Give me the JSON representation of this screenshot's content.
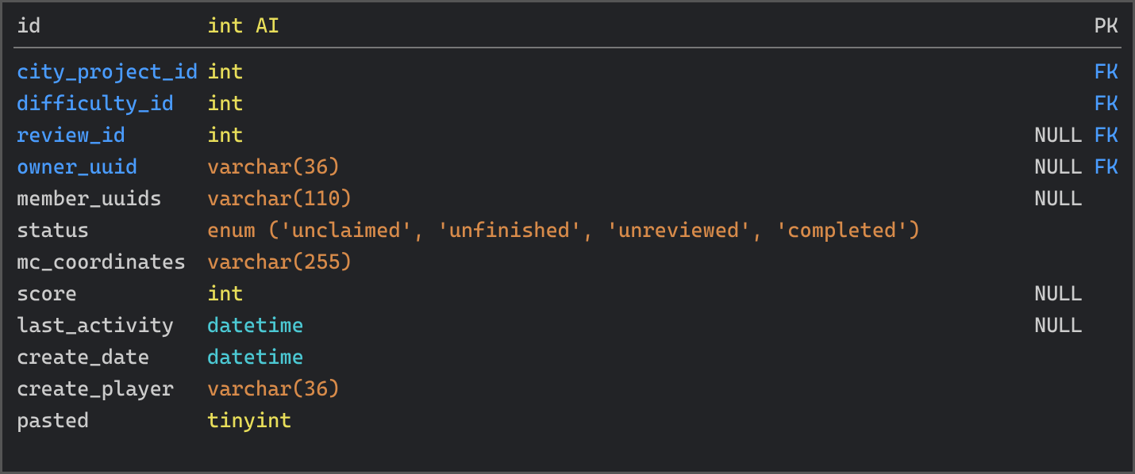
{
  "schema": {
    "pk_row": {
      "name": "id",
      "type_parts": [
        {
          "text": "int",
          "cls": "c-yellow"
        },
        {
          "text": " ",
          "cls": "c-yellow"
        },
        {
          "text": "AI",
          "cls": "c-yellow"
        }
      ],
      "nullable": "",
      "key": "PK",
      "name_cls": "c-plain",
      "key_cls": "c-plain"
    },
    "rows": [
      {
        "name": "city_project_id",
        "type_parts": [
          {
            "text": "int",
            "cls": "c-yellow"
          }
        ],
        "nullable": "",
        "key": "FK",
        "name_cls": "c-blue",
        "key_cls": "c-blue"
      },
      {
        "name": "difficulty_id",
        "type_parts": [
          {
            "text": "int",
            "cls": "c-yellow"
          }
        ],
        "nullable": "",
        "key": "FK",
        "name_cls": "c-blue",
        "key_cls": "c-blue"
      },
      {
        "name": "review_id",
        "type_parts": [
          {
            "text": "int",
            "cls": "c-yellow"
          }
        ],
        "nullable": "NULL",
        "key": "FK",
        "name_cls": "c-blue",
        "key_cls": "c-blue"
      },
      {
        "name": "owner_uuid",
        "type_parts": [
          {
            "text": "varchar",
            "cls": "c-orange"
          },
          {
            "text": "(",
            "cls": "c-orange"
          },
          {
            "text": "36",
            "cls": "c-orange"
          },
          {
            "text": ")",
            "cls": "c-orange"
          }
        ],
        "nullable": "NULL",
        "key": "FK",
        "name_cls": "c-blue",
        "key_cls": "c-blue"
      },
      {
        "name": "member_uuids",
        "type_parts": [
          {
            "text": "varchar",
            "cls": "c-orange"
          },
          {
            "text": "(",
            "cls": "c-orange"
          },
          {
            "text": "110",
            "cls": "c-orange"
          },
          {
            "text": ")",
            "cls": "c-orange"
          }
        ],
        "nullable": "NULL",
        "key": "",
        "name_cls": "c-plain",
        "key_cls": "c-plain"
      },
      {
        "name": "status",
        "type_parts": [
          {
            "text": "enum ('unclaimed', 'unfinished', 'unreviewed', 'completed')",
            "cls": "c-orange"
          }
        ],
        "nullable": "",
        "key": "",
        "name_cls": "c-plain",
        "key_cls": "c-plain"
      },
      {
        "name": "mc_coordinates",
        "type_parts": [
          {
            "text": "varchar",
            "cls": "c-orange"
          },
          {
            "text": "(",
            "cls": "c-orange"
          },
          {
            "text": "255",
            "cls": "c-orange"
          },
          {
            "text": ")",
            "cls": "c-orange"
          }
        ],
        "nullable": "",
        "key": "",
        "name_cls": "c-plain",
        "key_cls": "c-plain"
      },
      {
        "name": "score",
        "type_parts": [
          {
            "text": "int",
            "cls": "c-yellow"
          }
        ],
        "nullable": "NULL",
        "key": "",
        "name_cls": "c-plain",
        "key_cls": "c-plain"
      },
      {
        "name": "last_activity",
        "type_parts": [
          {
            "text": "datetime",
            "cls": "c-cyan"
          }
        ],
        "nullable": "NULL",
        "key": "",
        "name_cls": "c-plain",
        "key_cls": "c-plain"
      },
      {
        "name": "create_date",
        "type_parts": [
          {
            "text": "datetime",
            "cls": "c-cyan"
          }
        ],
        "nullable": "",
        "key": "",
        "name_cls": "c-plain",
        "key_cls": "c-plain"
      },
      {
        "name": "create_player",
        "type_parts": [
          {
            "text": "varchar",
            "cls": "c-orange"
          },
          {
            "text": "(",
            "cls": "c-orange"
          },
          {
            "text": "36",
            "cls": "c-orange"
          },
          {
            "text": ")",
            "cls": "c-orange"
          }
        ],
        "nullable": "",
        "key": "",
        "name_cls": "c-plain",
        "key_cls": "c-plain"
      },
      {
        "name": "pasted",
        "type_parts": [
          {
            "text": "tinyint",
            "cls": "c-yellow"
          }
        ],
        "nullable": "",
        "key": "",
        "name_cls": "c-plain",
        "key_cls": "c-plain"
      }
    ]
  }
}
